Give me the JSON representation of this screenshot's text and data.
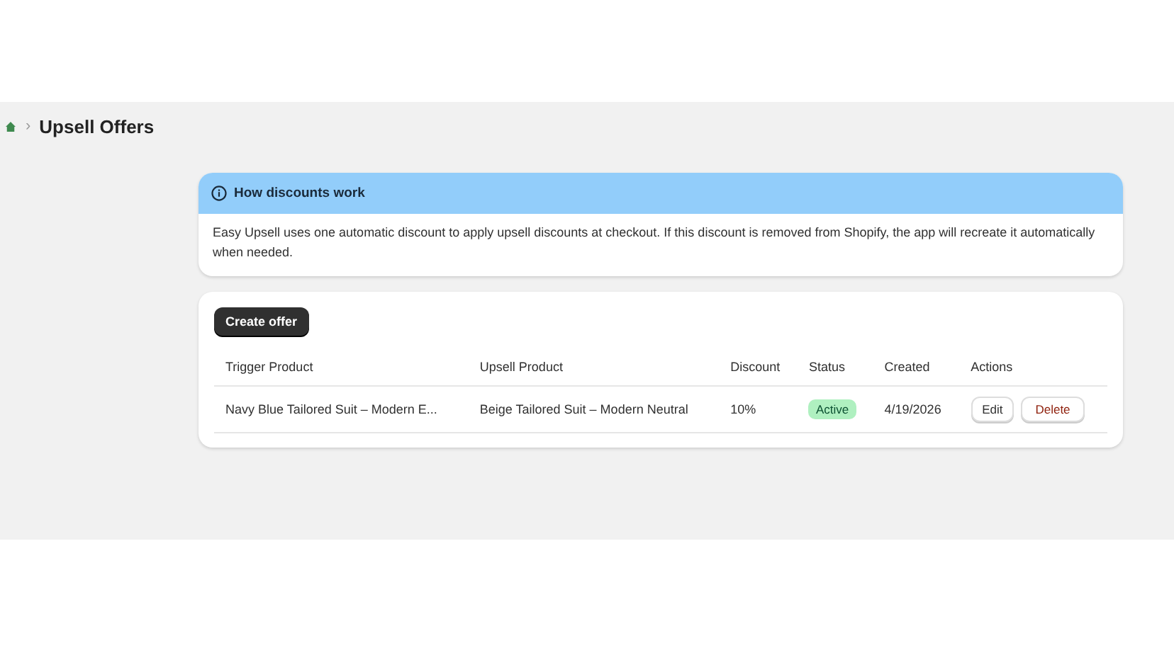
{
  "breadcrumb": {
    "separator": "›",
    "title": "Upsell Offers"
  },
  "info_banner": {
    "title": "How discounts work",
    "body": "Easy Upsell uses one automatic discount to apply upsell discounts at checkout. If this discount is removed from Shopify, the app will recreate it automatically when needed."
  },
  "offers": {
    "create_button": "Create offer",
    "columns": [
      "Trigger Product",
      "Upsell Product",
      "Discount",
      "Status",
      "Created",
      "Actions"
    ],
    "rows": [
      {
        "trigger_product": "Navy Blue Tailored Suit – Modern E...",
        "upsell_product": "Beige Tailored Suit – Modern Neutral",
        "discount": "10%",
        "status": {
          "label": "Active",
          "kind": "success"
        },
        "created": "4/19/2026",
        "actions": [
          {
            "label": "Edit",
            "kind": "default"
          },
          {
            "label": "Delete",
            "kind": "destructive"
          }
        ]
      }
    ]
  }
}
